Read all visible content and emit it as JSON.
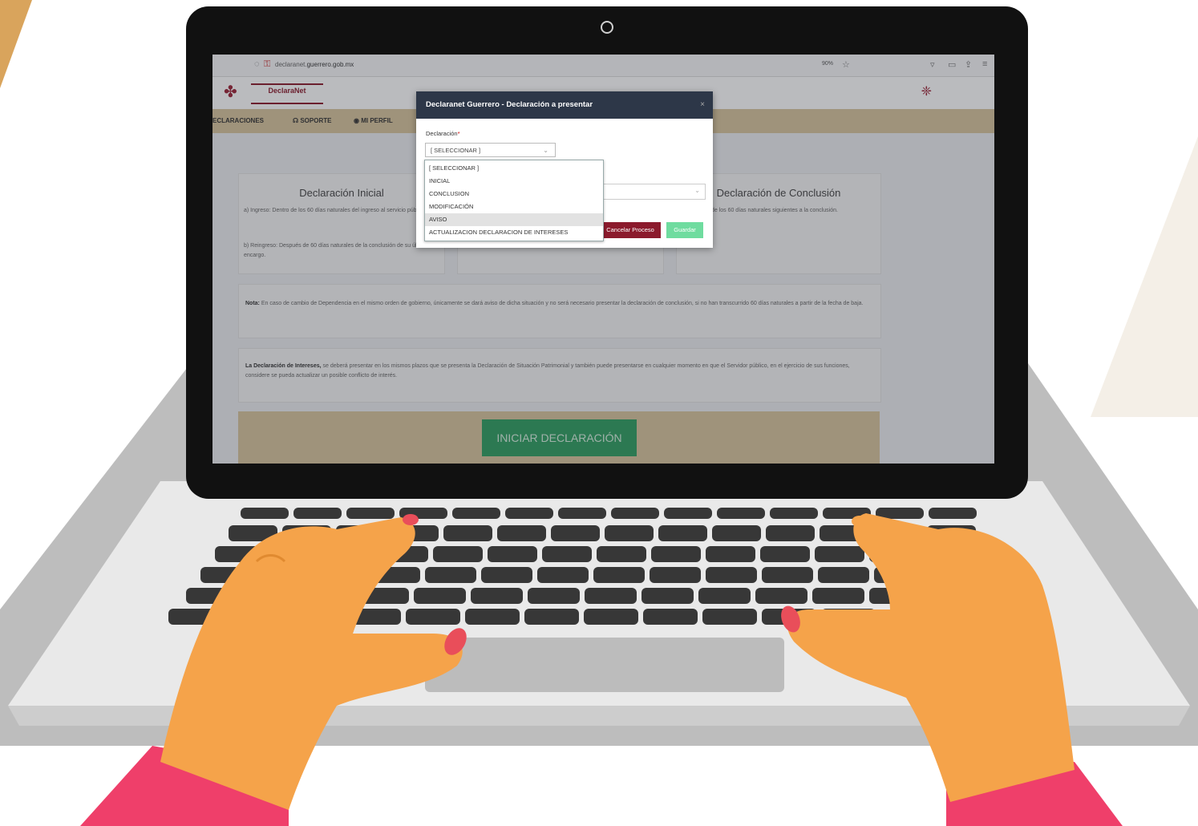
{
  "browser": {
    "url_prefix": "declaranet.",
    "url_domain": "guerrero.gob.mx",
    "zoom": "90%"
  },
  "site": {
    "logo_text": "DeclaraNet",
    "nav": [
      {
        "label": "ECLARACIONES"
      },
      {
        "label": "SOPORTE"
      },
      {
        "label": "MI PERFIL"
      }
    ],
    "cards": [
      {
        "title": "Declaración Inicial",
        "text1": "a) Ingreso: Dentro de los 60 días naturales del ingreso al servicio público.",
        "text2": "b) Reingreso: Después de 60 días naturales de la conclusión de su último encargo."
      },
      {
        "title": "Declaración de Conclusión",
        "text1": "Dentro de los 60 días naturales siguientes a la conclusión."
      }
    ],
    "note_label": "Nota:",
    "note_text": "En caso de cambio de Dependencia en el mismo orden de gobierno, únicamente se dará aviso de dicha situación y no será necesario presentar la declaración de conclusión, si no han transcurrido 60 días naturales a partir de la fecha de baja.",
    "interests_label": "La Declaración de Intereses,",
    "interests_text": "se deberá presentar en los mismos plazos que se presenta la Declaración de Situación Patrimonial y también puede presentarse en cualquier momento en que el Servidor público, en el ejercicio de sus funciones, considere se pueda actualizar un posible conflicto de interés.",
    "start_button": "INICIAR DECLARACIÓN"
  },
  "modal": {
    "title": "Declaranet Guerrero - Declaración a presentar",
    "close": "×",
    "field_label": "Declaración",
    "required_mark": "*",
    "selected_value": "[ SELECCIONAR ]",
    "options": [
      "[ SELECCIONAR ]",
      "INICIAL",
      "CONCLUSION",
      "MODIFICACIÓN",
      "AVISO",
      "ACTUALIZACION DECLARACION DE INTERESES"
    ],
    "highlighted_option": "AVISO",
    "cancel_button": "Cancelar Proceso",
    "save_button": "Guardar"
  },
  "colors": {
    "brand": "#8b1a2c",
    "navbar": "#d8c59c",
    "modal_header": "#2d3748",
    "start_button": "#2e9e60",
    "skin": "#f5a34a",
    "nails": "#e94e5a",
    "sleeve": "#ef3f6a"
  }
}
